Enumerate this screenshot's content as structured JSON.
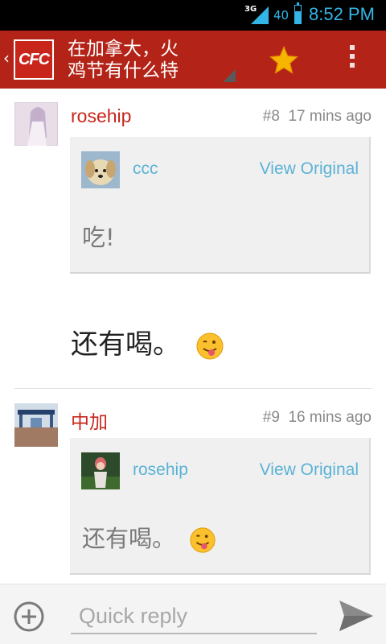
{
  "status_bar": {
    "network": "3G",
    "signal_label": "40",
    "time": "8:52 PM"
  },
  "action_bar": {
    "back_icon": "chevron-left-icon",
    "logo_text": "CFC",
    "title_line1": "在加拿大，火",
    "title_line2": "鸡节有什么特",
    "star_icon": "star-icon",
    "overflow_icon": "overflow-menu-icon",
    "star_color": "#f7b500"
  },
  "posts": [
    {
      "author": "rosehip",
      "number": "#8",
      "time": "17 mins ago",
      "quote": {
        "author": "ccc",
        "view_original": "View Original",
        "text": "吃!"
      },
      "body": "还有喝。"
    },
    {
      "author": "中加",
      "number": "#9",
      "time": "16 mins ago",
      "quote": {
        "author": "rosehip",
        "view_original": "View Original",
        "text": "还有喝。"
      }
    }
  ],
  "reply_bar": {
    "placeholder": "Quick reply",
    "add_icon": "add-circle-icon",
    "send_icon": "send-icon"
  },
  "colors": {
    "action_bar": "#b32317",
    "accent": "#33b5e5",
    "author": "#c8261b",
    "link": "#5bb2d6"
  }
}
